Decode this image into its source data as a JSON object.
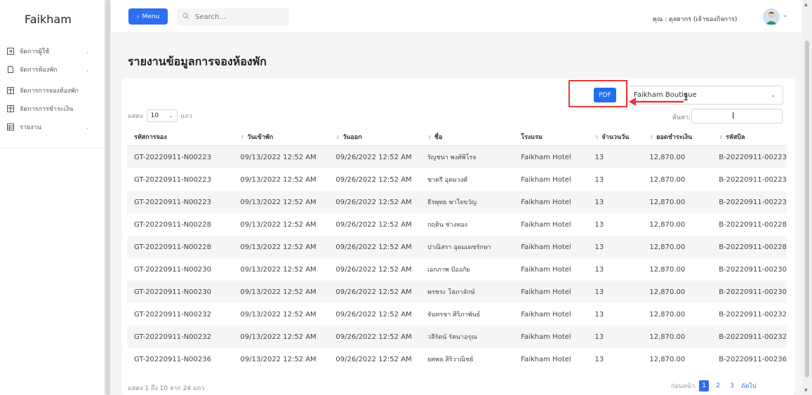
{
  "sidebar": {
    "brand": "Faikham",
    "items": [
      {
        "label": "จัดการผู้ใช้",
        "icon": "user-edit-icon",
        "chevron": true
      },
      {
        "label": "จัดการห้องพัก",
        "icon": "file-icon",
        "chevron": true
      },
      {
        "label": "จัดการการจองห้องพัก",
        "icon": "table-icon",
        "chevron": false
      },
      {
        "label": "จัดการการชำระเงิน",
        "icon": "table-icon",
        "chevron": false
      },
      {
        "label": "รายงาน",
        "icon": "report-icon",
        "chevron": true
      }
    ]
  },
  "topbar": {
    "menu_label": "Menu",
    "search_placeholder": "Search...",
    "user_label": "คุณ : ดุลยากร (เจ้าของกิจการ)"
  },
  "page": {
    "title": "รายงานข้อมูลการจองห้องพัก",
    "pdf_label": "PDF",
    "hotel_selected": "Faikham Boutique",
    "annotation_number": "1",
    "show_prefix": "แสดง",
    "entries_value": "10",
    "show_suffix": "แถว",
    "search_label": "ค้นหา:",
    "footer_info": "แสดง 1 ถึง 10 จาก 24 แถว",
    "pagination": {
      "prev": "ก่อนหน้า",
      "pages": [
        "1",
        "2",
        "3"
      ],
      "active": "1",
      "next": "ถัดไป"
    }
  },
  "table": {
    "headers": [
      "รหัสการจอง",
      "วันเข้าพัก",
      "วันออก",
      "ชื่อ",
      "โรงแรม",
      "จำนวนวัน",
      "ยอดชำระเงิน",
      "รหัสบิล"
    ],
    "rows": [
      [
        "GT-20220911-N00223",
        "09/13/2022 12:52 AM",
        "09/26/2022 12:52 AM",
        "รัญชนา พงศ์พิโรจ",
        "Faikham Hotel",
        "13",
        "12,870.00",
        "B-20220911-00223"
      ],
      [
        "GT-20220911-N00223",
        "09/13/2022 12:52 AM",
        "09/26/2022 12:52 AM",
        "ชาตรี อุดมวงศ์",
        "Faikham Hotel",
        "13",
        "12,870.00",
        "B-20220911-00223"
      ],
      [
        "GT-20220911-N00223",
        "09/13/2022 12:52 AM",
        "09/26/2022 12:52 AM",
        "ธีรพุทธ พาใจขวัญ",
        "Faikham Hotel",
        "13",
        "12,870.00",
        "B-20220911-00223"
      ],
      [
        "GT-20220911-N00228",
        "09/13/2022 12:52 AM",
        "09/26/2022 12:52 AM",
        "กฤติน ช่างทอง",
        "Faikham Hotel",
        "13",
        "12,870.00",
        "B-20220911-00228"
      ],
      [
        "GT-20220911-N00228",
        "09/13/2022 12:52 AM",
        "09/26/2022 12:52 AM",
        "ปาณิสรา อุดมเดชรักษา",
        "Faikham Hotel",
        "13",
        "12,870.00",
        "B-20220911-00228"
      ],
      [
        "GT-20220911-N00230",
        "09/13/2022 12:52 AM",
        "09/26/2022 12:52 AM",
        "เอกภาพ ป้องภัย",
        "Faikham Hotel",
        "13",
        "12,870.00",
        "B-20220911-00230"
      ],
      [
        "GT-20220911-N00230",
        "09/13/2022 12:52 AM",
        "09/26/2022 12:52 AM",
        "พรชระ โสภาลักษ์",
        "Faikham Hotel",
        "13",
        "12,870.00",
        "B-20220911-00230"
      ],
      [
        "GT-20220911-N00232",
        "09/13/2022 12:52 AM",
        "09/26/2022 12:52 AM",
        "จันทรชา ศิริภาพันธ์",
        "Faikham Hotel",
        "13",
        "12,870.00",
        "B-20220911-00232"
      ],
      [
        "GT-20220911-N00232",
        "09/13/2022 12:52 AM",
        "09/26/2022 12:52 AM",
        "วลีรัตน์ รัตนาอรุณ",
        "Faikham Hotel",
        "13",
        "12,870.00",
        "B-20220911-00232"
      ],
      [
        "GT-20220911-N00236",
        "09/13/2022 12:52 AM",
        "09/26/2022 12:52 AM",
        "ยศพล สิริวาณิชย์",
        "Faikham Hotel",
        "13",
        "12,870.00",
        "B-20220911-00236"
      ]
    ]
  },
  "colors": {
    "accent": "#2d6ff2",
    "annotation": "#e53935",
    "stripe": "#f5f5f5"
  }
}
